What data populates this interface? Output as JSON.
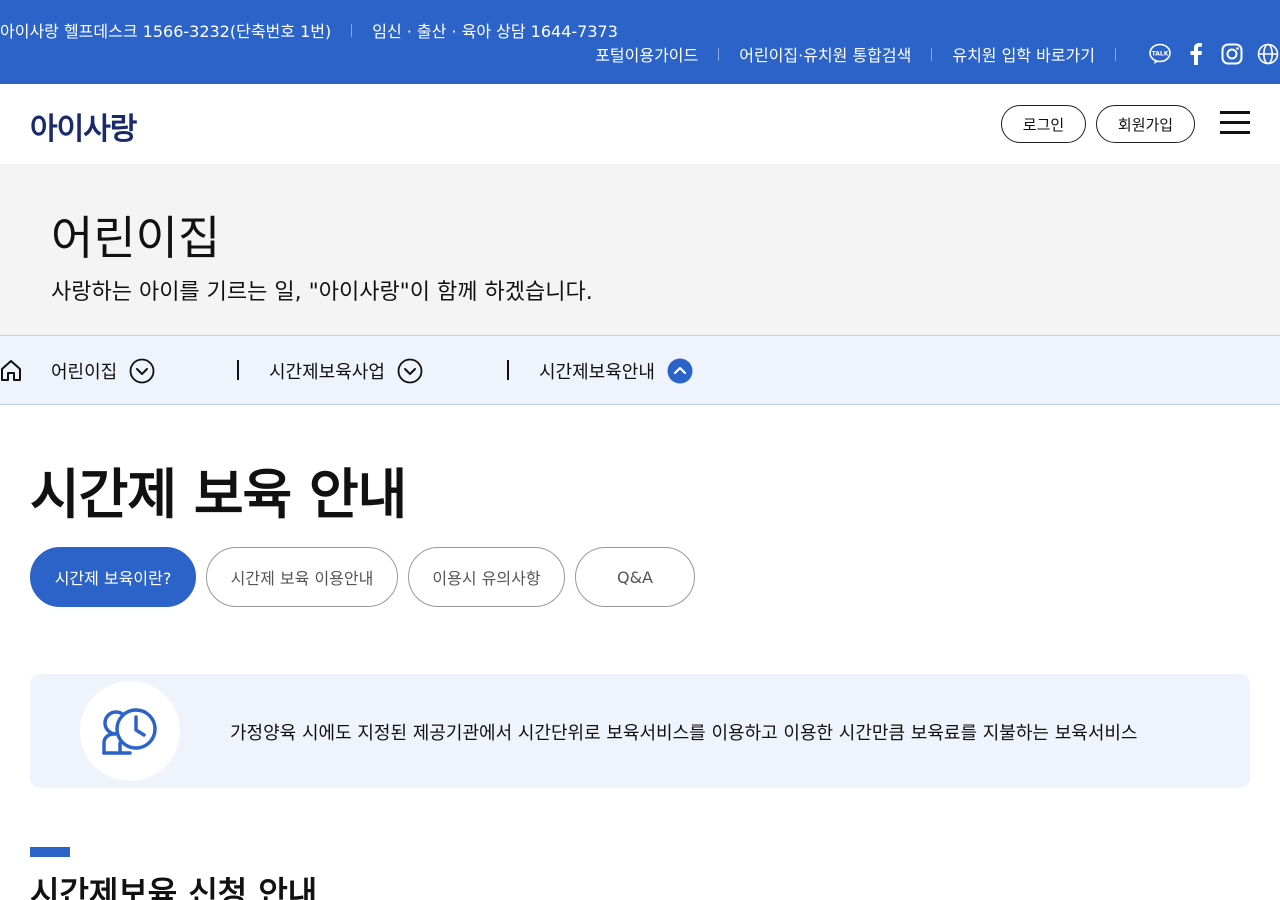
{
  "topbar": {
    "helpdesk": "아이사랑 헬프데스크 1566-3232(단축번호 1번)",
    "consult": "임신 · 출산 · 육아 상담 1644-7373",
    "links": [
      "포털이용가이드",
      "어린이집·유치원 통합검색",
      "유치원 입학 바로가기"
    ],
    "social_icons": [
      "kakao-talk-icon",
      "facebook-icon",
      "instagram-icon",
      "globe-icon"
    ]
  },
  "header": {
    "logo": "아이사랑",
    "login_label": "로그인",
    "join_label": "회원가입"
  },
  "hero": {
    "title": "어린이집",
    "subtitle": "사랑하는 아이를 기르는 일, \"아이사랑\"이 함께 하겠습니다."
  },
  "breadcrumb": {
    "items": [
      "어린이집",
      "시간제보육사업",
      "시간제보육안내"
    ]
  },
  "page": {
    "title": "시간제 보육 안내"
  },
  "tabs": [
    {
      "label": "시간제 보육이란?",
      "active": true
    },
    {
      "label": "시간제 보육 이용안내",
      "active": false
    },
    {
      "label": "이용시 유의사항",
      "active": false
    },
    {
      "label": "Q&A",
      "active": false
    }
  ],
  "info": {
    "text": "가정양육 시에도 지정된 제공기관에서 시간단위로 보육서비스를 이용하고 이용한 시간만큼 보육료를 지불하는 보육서비스"
  },
  "section": {
    "title": "시간제보육 신청 안내"
  },
  "colors": {
    "primary": "#2c63c8",
    "light_bg": "#eef3fc",
    "hero_bg": "#f4f4f4"
  }
}
